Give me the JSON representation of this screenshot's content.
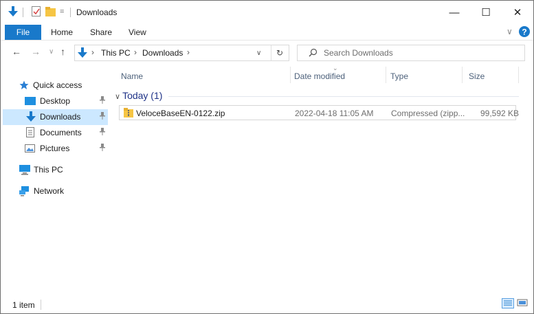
{
  "window": {
    "title": "Downloads",
    "qat_dropdown": "=",
    "controls": {
      "minimize": "—",
      "maximize": "☐",
      "close": "✕"
    }
  },
  "ribbon": {
    "tabs": [
      "File",
      "Home",
      "Share",
      "View"
    ],
    "expand_glyph": "∨",
    "help_glyph": "?"
  },
  "nav": {
    "back": "←",
    "forward": "→",
    "recent": "∨",
    "up": "↑",
    "breadcrumb": [
      "This PC",
      "Downloads"
    ],
    "breadcrumb_sep": "›",
    "address_dropdown": "∨",
    "refresh": "↻",
    "search_placeholder": "Search Downloads"
  },
  "sidebar": {
    "items": [
      {
        "label": "Quick access",
        "icon": "star-icon",
        "pinned": false
      },
      {
        "label": "Desktop",
        "icon": "desktop-icon",
        "pinned": true
      },
      {
        "label": "Downloads",
        "icon": "downloads-icon",
        "pinned": true,
        "selected": true
      },
      {
        "label": "Documents",
        "icon": "documents-icon",
        "pinned": true
      },
      {
        "label": "Pictures",
        "icon": "pictures-icon",
        "pinned": true
      },
      {
        "label": "This PC",
        "icon": "this-pc-icon",
        "pinned": false
      },
      {
        "label": "Network",
        "icon": "network-icon",
        "pinned": false
      }
    ],
    "pin_glyph": "📌"
  },
  "content": {
    "columns": [
      "Name",
      "Date modified",
      "Type",
      "Size"
    ],
    "sort_glyph": "⌄",
    "group": {
      "label": "Today (1)",
      "toggle": "∨"
    },
    "files": [
      {
        "name": "VeloceBaseEN-0122.zip",
        "date_modified": "2022-04-18 11:05 AM",
        "type": "Compressed (zipp...",
        "size": "99,592 KB",
        "icon": "zip-folder-icon"
      }
    ]
  },
  "status": {
    "item_count": "1 item"
  },
  "colors": {
    "accent": "#1979ca",
    "selection": "#cce8ff",
    "group_header": "#1e3287",
    "column_header": "#4c607a"
  }
}
